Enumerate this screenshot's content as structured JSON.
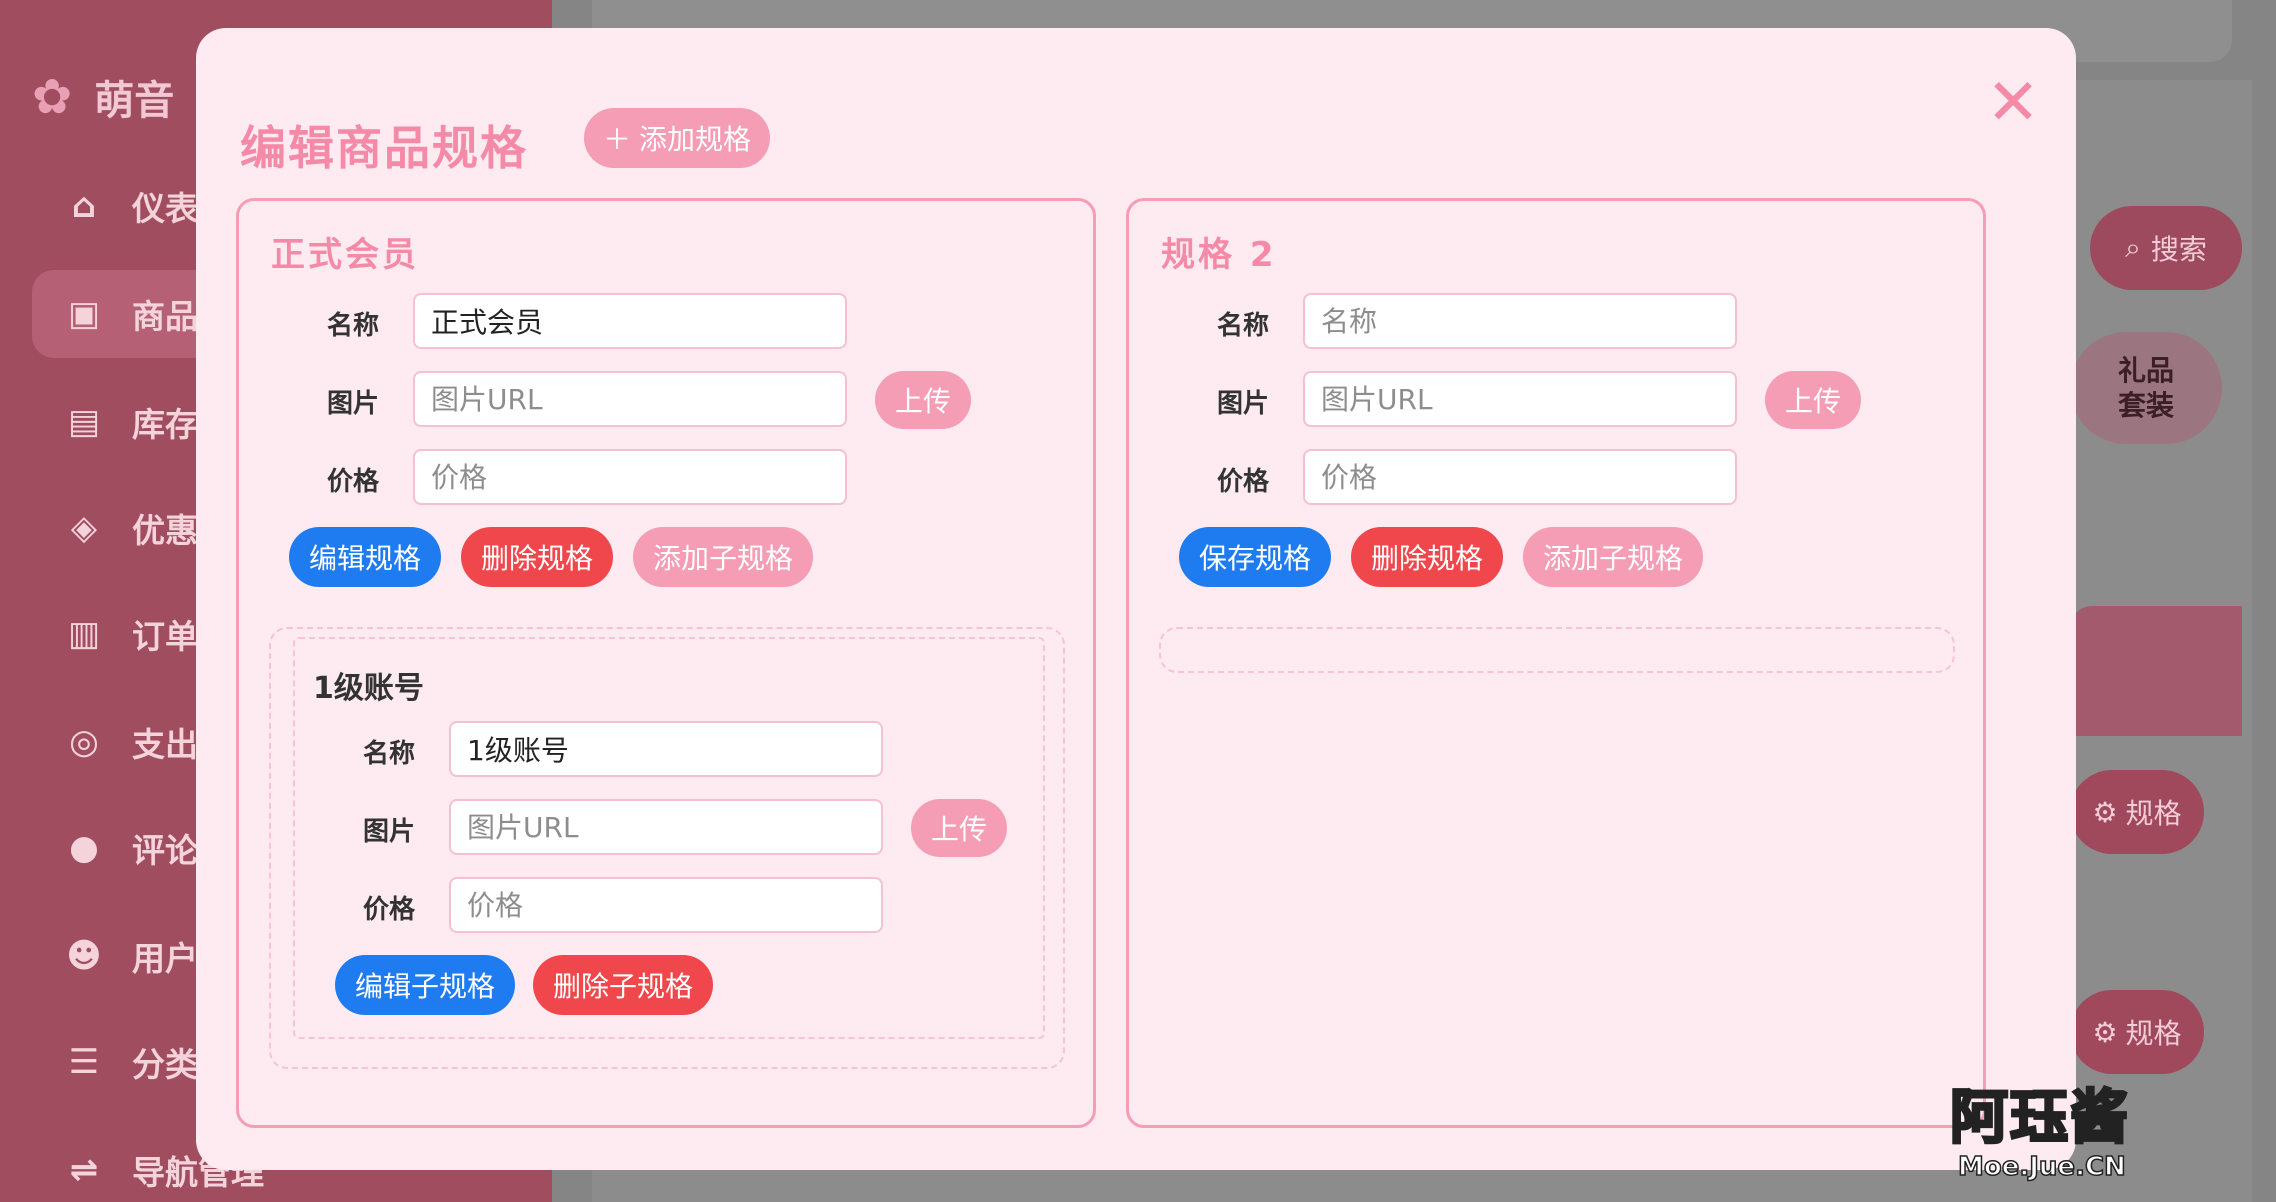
{
  "sidebar": {
    "logo_text": "萌音",
    "items": [
      {
        "label": "仪表盘",
        "icon": "home-icon"
      },
      {
        "label": "商品管理",
        "icon": "bag-icon"
      },
      {
        "label": "库存管理",
        "icon": "box-icon"
      },
      {
        "label": "优惠管理",
        "icon": "tag-icon"
      },
      {
        "label": "订单管理",
        "icon": "clipboard-icon"
      },
      {
        "label": "支出管理",
        "icon": "coins-icon"
      },
      {
        "label": "评论管理",
        "icon": "comment-icon"
      },
      {
        "label": "用户管理",
        "icon": "users-icon"
      },
      {
        "label": "分类管理",
        "icon": "list-icon"
      },
      {
        "label": "导航管理",
        "icon": "signpost-icon"
      }
    ]
  },
  "background": {
    "search_label": "搜索",
    "gift_chip": "礼品\n套装",
    "spec_chip_label": "规格"
  },
  "modal": {
    "title": "编辑商品规格",
    "add_spec_label": "添加规格",
    "close_glyph": "✕"
  },
  "labels": {
    "name": "名称",
    "image": "图片",
    "price": "价格",
    "upload": "上传",
    "name_placeholder": "名称",
    "image_placeholder": "图片URL",
    "price_placeholder": "价格"
  },
  "specs": [
    {
      "title": "正式会员",
      "name_value": "正式会员",
      "image_value": "",
      "price_value": "",
      "buttons": {
        "primary": "编辑规格",
        "delete": "删除规格",
        "add_sub": "添加子规格"
      },
      "sub_specs": [
        {
          "title": "1级账号",
          "name_value": "1级账号",
          "image_value": "",
          "price_value": "",
          "buttons": {
            "edit": "编辑子规格",
            "delete": "删除子规格"
          }
        }
      ]
    },
    {
      "title": "规格 2",
      "name_value": "",
      "image_value": "",
      "price_value": "",
      "buttons": {
        "primary": "保存规格",
        "delete": "删除规格",
        "add_sub": "添加子规格"
      },
      "sub_specs": []
    }
  ],
  "watermark": {
    "big": "阿珏酱",
    "small": "Moe.Jue.CN"
  },
  "colors": {
    "accent_pink": "#f48aa8",
    "button_pink": "#f59db5",
    "blue": "#1f7cf0",
    "red": "#f0474d",
    "modal_bg": "#fdebf1"
  }
}
